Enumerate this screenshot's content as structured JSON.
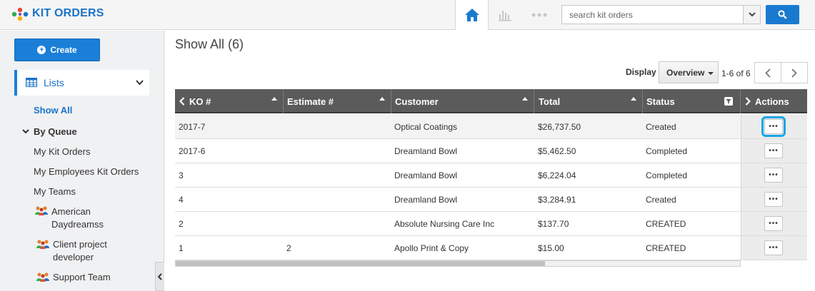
{
  "header": {
    "app_title": "KIT ORDERS",
    "search_placeholder": "search kit orders",
    "accent": "#1a73c9"
  },
  "sidebar": {
    "create_label": "Create",
    "lists_label": "Lists",
    "show_all": "Show All",
    "by_queue": "By Queue",
    "queue_items": [
      "My Kit Orders",
      "My Employees Kit Orders",
      "My Teams"
    ],
    "teams": [
      {
        "line1": "American",
        "line2": "Daydreamss"
      },
      {
        "line1": "Client project",
        "line2": "developer"
      },
      {
        "line1": "Support Team",
        "line2": ""
      }
    ]
  },
  "main": {
    "title": "Show All (6)",
    "display_label": "Display",
    "display_value": "Overview",
    "page_count": "1-6 of 6"
  },
  "table": {
    "columns": [
      "KO #",
      "Estimate #",
      "Customer",
      "Total",
      "Status",
      "Actions"
    ],
    "rows": [
      {
        "ko": "2017-7",
        "estimate": "",
        "customer": "Optical Coatings",
        "total": "$26,737.50",
        "status": "Created"
      },
      {
        "ko": "2017-6",
        "estimate": "",
        "customer": "Dreamland Bowl",
        "total": "$5,462.50",
        "status": "Completed"
      },
      {
        "ko": "3",
        "estimate": "",
        "customer": "Dreamland Bowl",
        "total": "$6,224.04",
        "status": "Completed"
      },
      {
        "ko": "4",
        "estimate": "",
        "customer": "Dreamland Bowl",
        "total": "$3,284.91",
        "status": "Created"
      },
      {
        "ko": "2",
        "estimate": "",
        "customer": "Absolute Nursing Care Inc",
        "total": "$137.70",
        "status": "CREATED"
      },
      {
        "ko": "1",
        "estimate": "2",
        "customer": "Apollo Print & Copy",
        "total": "$15.00",
        "status": "CREATED"
      }
    ],
    "action_glyph": "•••"
  }
}
